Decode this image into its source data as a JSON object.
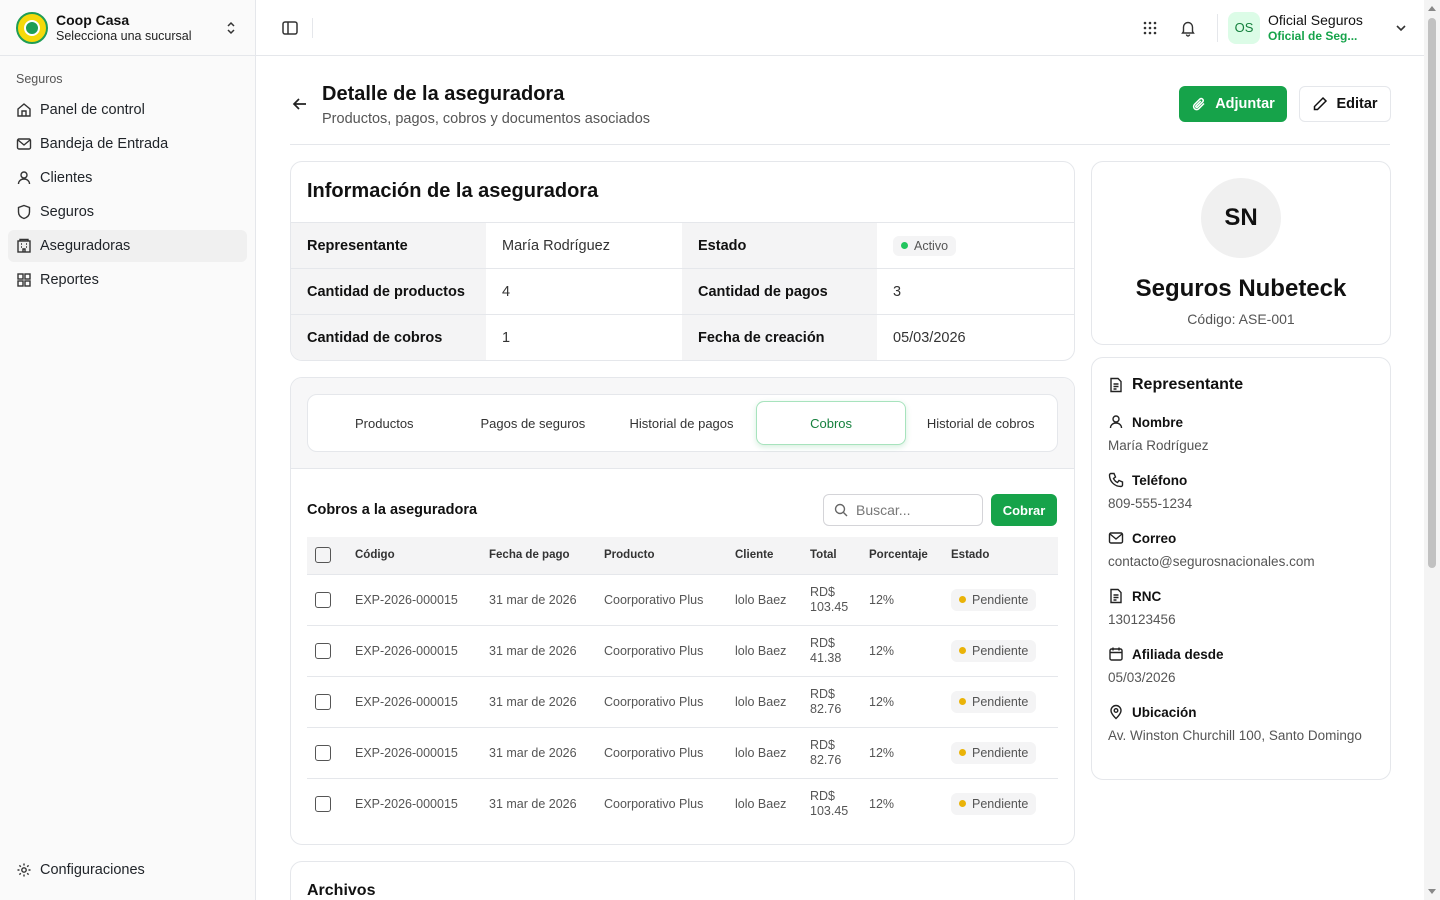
{
  "org": {
    "name": "Coop Casa",
    "subtitle": "Selecciona una sucursal"
  },
  "sidebar": {
    "section_label": "Seguros",
    "items": [
      {
        "label": "Panel de control",
        "icon": "home-icon"
      },
      {
        "label": "Bandeja de Entrada",
        "icon": "mail-icon"
      },
      {
        "label": "Clientes",
        "icon": "user-icon"
      },
      {
        "label": "Seguros",
        "icon": "shield-icon"
      },
      {
        "label": "Aseguradoras",
        "icon": "building-icon",
        "active": true
      },
      {
        "label": "Reportes",
        "icon": "grid-icon"
      }
    ],
    "settings_label": "Configuraciones"
  },
  "user": {
    "initials": "OS",
    "name": "Oficial Seguros",
    "role": "Oficial de Seguros"
  },
  "page": {
    "title": "Detalle de la aseguradora",
    "subtitle": "Productos, pagos, cobros y documentos asociados",
    "attach_label": "Adjuntar",
    "edit_label": "Editar"
  },
  "info": {
    "title": "Información de la aseguradora",
    "representante_label": "Representante",
    "representante": "María Rodríguez",
    "estado_label": "Estado",
    "estado": "Activo",
    "productos_label": "Cantidad de productos",
    "productos": "4",
    "pagos_label": "Cantidad de pagos",
    "pagos": "3",
    "cobros_label": "Cantidad de cobros",
    "cobros": "1",
    "fecha_label": "Fecha de creación",
    "fecha": "05/03/2026"
  },
  "tabs": [
    "Productos",
    "Pagos de seguros",
    "Historial de pagos",
    "Cobros",
    "Historial de cobros"
  ],
  "active_tab": "Cobros",
  "cobros": {
    "title": "Cobros a la aseguradora",
    "search_placeholder": "Buscar...",
    "cobrar_label": "Cobrar",
    "columns": [
      "Código",
      "Fecha de pago",
      "Producto",
      "Cliente",
      "Total",
      "Porcentaje",
      "Estado"
    ],
    "rows": [
      {
        "codigo": "EXP-2026-000015",
        "fecha": "31 mar de 2026",
        "producto": "Coorporativo Plus",
        "cliente": "lolo Baez",
        "moneda": "RD$",
        "monto": "103.45",
        "porcentaje": "12%",
        "estado": "Pendiente"
      },
      {
        "codigo": "EXP-2026-000015",
        "fecha": "31 mar de 2026",
        "producto": "Coorporativo Plus",
        "cliente": "lolo Baez",
        "moneda": "RD$",
        "monto": "41.38",
        "porcentaje": "12%",
        "estado": "Pendiente"
      },
      {
        "codigo": "EXP-2026-000015",
        "fecha": "31 mar de 2026",
        "producto": "Coorporativo Plus",
        "cliente": "lolo Baez",
        "moneda": "RD$",
        "monto": "82.76",
        "porcentaje": "12%",
        "estado": "Pendiente"
      },
      {
        "codigo": "EXP-2026-000015",
        "fecha": "31 mar de 2026",
        "producto": "Coorporativo Plus",
        "cliente": "lolo Baez",
        "moneda": "RD$",
        "monto": "82.76",
        "porcentaje": "12%",
        "estado": "Pendiente"
      },
      {
        "codigo": "EXP-2026-000015",
        "fecha": "31 mar de 2026",
        "producto": "Coorporativo Plus",
        "cliente": "lolo Baez",
        "moneda": "RD$",
        "monto": "103.45",
        "porcentaje": "12%",
        "estado": "Pendiente"
      }
    ]
  },
  "files": {
    "title": "Archivos"
  },
  "profile": {
    "initials": "SN",
    "name": "Seguros Nubeteck",
    "code": "Código: ASE-001"
  },
  "rep": {
    "title": "Representante",
    "nombre_label": "Nombre",
    "nombre": "María Rodríguez",
    "telefono_label": "Teléfono",
    "telefono": "809-555-1234",
    "correo_label": "Correo",
    "correo": "contacto@segurosnacionales.com",
    "rnc_label": "RNC",
    "rnc": "130123456",
    "afiliada_label": "Afiliada desde",
    "afiliada": "05/03/2026",
    "ubicacion_label": "Ubicación",
    "ubicacion": "Av. Winston Churchill 100, Santo Domingo"
  },
  "colors": {
    "brand_green": "#16a34a",
    "active_dot": "#22c55e",
    "pending_dot": "#eab308"
  }
}
